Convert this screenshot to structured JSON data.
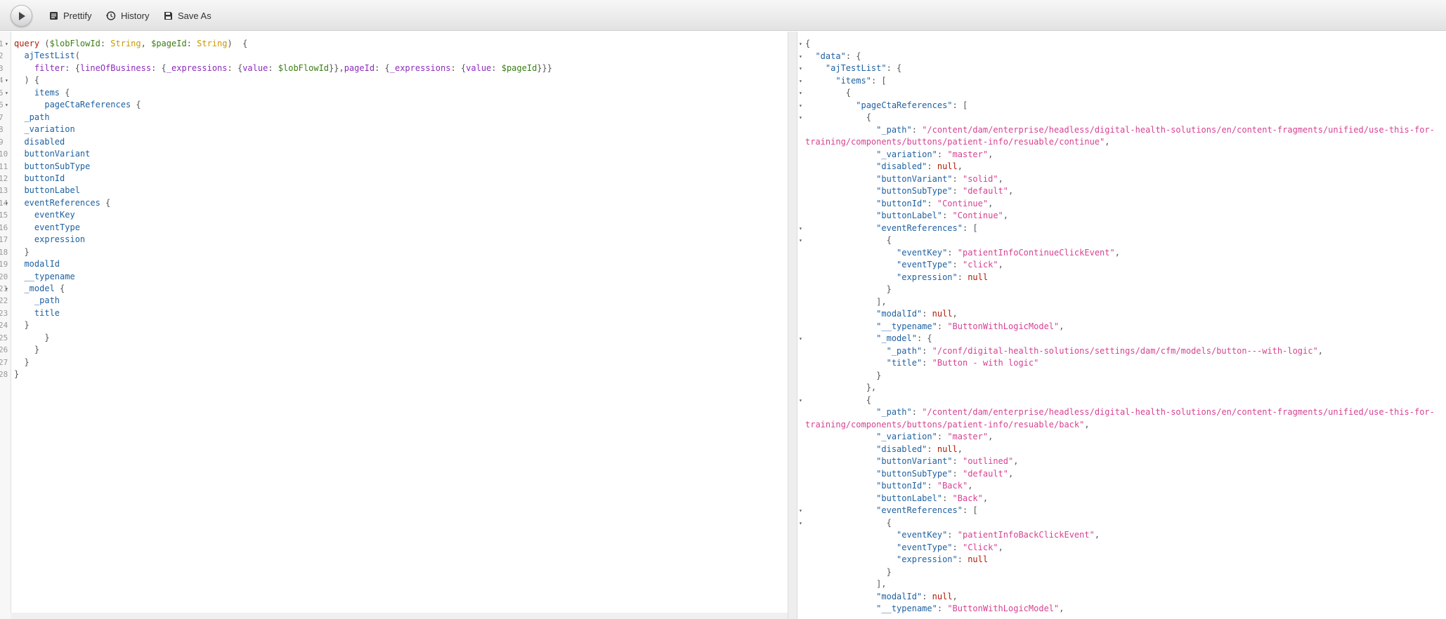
{
  "toolbar": {
    "run_label": "Execute Query",
    "prettify_label": "Prettify",
    "history_label": "History",
    "save_as_label": "Save As"
  },
  "query_lines": [
    {
      "n": "1",
      "fold": true,
      "tokens": [
        [
          "kw",
          "query"
        ],
        [
          "punc",
          " ("
        ],
        [
          "var",
          "$lobFlowId"
        ],
        [
          "punc",
          ": "
        ],
        [
          "type",
          "String"
        ],
        [
          "punc",
          ", "
        ],
        [
          "var",
          "$pageId"
        ],
        [
          "punc",
          ": "
        ],
        [
          "type",
          "String"
        ],
        [
          "punc",
          ")  {"
        ]
      ]
    },
    {
      "n": "2",
      "fold": false,
      "tokens": [
        [
          "punc",
          "  "
        ],
        [
          "prop",
          "ajTestList"
        ],
        [
          "punc",
          "("
        ]
      ]
    },
    {
      "n": "3",
      "fold": false,
      "tokens": [
        [
          "punc",
          "    "
        ],
        [
          "attr",
          "filter"
        ],
        [
          "punc",
          ": {"
        ],
        [
          "attr",
          "lineOfBusiness"
        ],
        [
          "punc",
          ": {"
        ],
        [
          "attr",
          "_expressions"
        ],
        [
          "punc",
          ": {"
        ],
        [
          "attr",
          "value"
        ],
        [
          "punc",
          ": "
        ],
        [
          "var",
          "$lobFlowId"
        ],
        [
          "punc",
          "}},"
        ],
        [
          "attr",
          "pageId"
        ],
        [
          "punc",
          ": {"
        ],
        [
          "attr",
          "_expressions"
        ],
        [
          "punc",
          ": {"
        ],
        [
          "attr",
          "value"
        ],
        [
          "punc",
          ": "
        ],
        [
          "var",
          "$pageId"
        ],
        [
          "punc",
          "}}}"
        ]
      ]
    },
    {
      "n": "4",
      "fold": true,
      "tokens": [
        [
          "punc",
          "  ) {"
        ]
      ]
    },
    {
      "n": "5",
      "fold": true,
      "tokens": [
        [
          "punc",
          "    "
        ],
        [
          "prop",
          "items"
        ],
        [
          "punc",
          " {"
        ]
      ]
    },
    {
      "n": "6",
      "fold": true,
      "tokens": [
        [
          "punc",
          "      "
        ],
        [
          "prop",
          "pageCtaReferences"
        ],
        [
          "punc",
          " {"
        ]
      ]
    },
    {
      "n": "7",
      "fold": false,
      "tokens": [
        [
          "punc",
          "  "
        ],
        [
          "prop",
          "_path"
        ]
      ]
    },
    {
      "n": "8",
      "fold": false,
      "tokens": [
        [
          "punc",
          "  "
        ],
        [
          "prop",
          "_variation"
        ]
      ]
    },
    {
      "n": "9",
      "fold": false,
      "tokens": [
        [
          "punc",
          "  "
        ],
        [
          "prop",
          "disabled"
        ]
      ]
    },
    {
      "n": "10",
      "fold": false,
      "tokens": [
        [
          "punc",
          "  "
        ],
        [
          "prop",
          "buttonVariant"
        ]
      ]
    },
    {
      "n": "11",
      "fold": false,
      "tokens": [
        [
          "punc",
          "  "
        ],
        [
          "prop",
          "buttonSubType"
        ]
      ]
    },
    {
      "n": "12",
      "fold": false,
      "tokens": [
        [
          "punc",
          "  "
        ],
        [
          "prop",
          "buttonId"
        ]
      ]
    },
    {
      "n": "13",
      "fold": false,
      "tokens": [
        [
          "punc",
          "  "
        ],
        [
          "prop",
          "buttonLabel"
        ]
      ]
    },
    {
      "n": "14",
      "fold": true,
      "tokens": [
        [
          "punc",
          "  "
        ],
        [
          "prop",
          "eventReferences"
        ],
        [
          "punc",
          " {"
        ]
      ]
    },
    {
      "n": "15",
      "fold": false,
      "tokens": [
        [
          "punc",
          "    "
        ],
        [
          "prop",
          "eventKey"
        ]
      ]
    },
    {
      "n": "16",
      "fold": false,
      "tokens": [
        [
          "punc",
          "    "
        ],
        [
          "prop",
          "eventType"
        ]
      ]
    },
    {
      "n": "17",
      "fold": false,
      "tokens": [
        [
          "punc",
          "    "
        ],
        [
          "prop",
          "expression"
        ]
      ]
    },
    {
      "n": "18",
      "fold": false,
      "tokens": [
        [
          "punc",
          "  }"
        ]
      ]
    },
    {
      "n": "19",
      "fold": false,
      "tokens": [
        [
          "punc",
          "  "
        ],
        [
          "prop",
          "modalId"
        ]
      ]
    },
    {
      "n": "20",
      "fold": false,
      "tokens": [
        [
          "punc",
          "  "
        ],
        [
          "prop",
          "__typename"
        ]
      ]
    },
    {
      "n": "21",
      "fold": true,
      "tokens": [
        [
          "punc",
          "  "
        ],
        [
          "prop",
          "_model"
        ],
        [
          "punc",
          " {"
        ]
      ]
    },
    {
      "n": "22",
      "fold": false,
      "tokens": [
        [
          "punc",
          "    "
        ],
        [
          "prop",
          "_path"
        ]
      ]
    },
    {
      "n": "23",
      "fold": false,
      "tokens": [
        [
          "punc",
          "    "
        ],
        [
          "prop",
          "title"
        ]
      ]
    },
    {
      "n": "24",
      "fold": false,
      "tokens": [
        [
          "punc",
          "  }"
        ]
      ]
    },
    {
      "n": "25",
      "fold": false,
      "tokens": [
        [
          "punc",
          "      }"
        ]
      ]
    },
    {
      "n": "26",
      "fold": false,
      "tokens": [
        [
          "punc",
          "    }"
        ]
      ]
    },
    {
      "n": "27",
      "fold": false,
      "tokens": [
        [
          "punc",
          "  }"
        ]
      ]
    },
    {
      "n": "28",
      "fold": false,
      "tokens": [
        [
          "punc",
          "}"
        ]
      ]
    }
  ],
  "result_lines": [
    {
      "fold": true,
      "tokens": [
        [
          "jp",
          "{"
        ]
      ]
    },
    {
      "fold": true,
      "tokens": [
        [
          "jp",
          "  "
        ],
        [
          "jkey",
          "\"data\""
        ],
        [
          "jp",
          ": {"
        ]
      ]
    },
    {
      "fold": true,
      "tokens": [
        [
          "jp",
          "    "
        ],
        [
          "jkey",
          "\"ajTestList\""
        ],
        [
          "jp",
          ": {"
        ]
      ]
    },
    {
      "fold": true,
      "tokens": [
        [
          "jp",
          "      "
        ],
        [
          "jkey",
          "\"items\""
        ],
        [
          "jp",
          ": ["
        ]
      ]
    },
    {
      "fold": true,
      "tokens": [
        [
          "jp",
          "        {"
        ]
      ]
    },
    {
      "fold": true,
      "tokens": [
        [
          "jp",
          "          "
        ],
        [
          "jkey",
          "\"pageCtaReferences\""
        ],
        [
          "jp",
          ": ["
        ]
      ]
    },
    {
      "fold": true,
      "tokens": [
        [
          "jp",
          "            {"
        ]
      ]
    },
    {
      "fold": false,
      "tokens": [
        [
          "jp",
          "              "
        ],
        [
          "jkey",
          "\"_path\""
        ],
        [
          "jp",
          ": "
        ],
        [
          "jstr",
          "\"/content/dam/enterprise/headless/digital-health-solutions/en/content-fragments/unified/use-this-for-"
        ]
      ]
    },
    {
      "fold": false,
      "tokens": [
        [
          "jstr",
          "training/components/buttons/patient-info/resuable/continue\""
        ],
        [
          "jp",
          ","
        ]
      ]
    },
    {
      "fold": false,
      "tokens": [
        [
          "jp",
          "              "
        ],
        [
          "jkey",
          "\"_variation\""
        ],
        [
          "jp",
          ": "
        ],
        [
          "jstr",
          "\"master\""
        ],
        [
          "jp",
          ","
        ]
      ]
    },
    {
      "fold": false,
      "tokens": [
        [
          "jp",
          "              "
        ],
        [
          "jkey",
          "\"disabled\""
        ],
        [
          "jp",
          ": "
        ],
        [
          "jnull",
          "null"
        ],
        [
          "jp",
          ","
        ]
      ]
    },
    {
      "fold": false,
      "tokens": [
        [
          "jp",
          "              "
        ],
        [
          "jkey",
          "\"buttonVariant\""
        ],
        [
          "jp",
          ": "
        ],
        [
          "jstr",
          "\"solid\""
        ],
        [
          "jp",
          ","
        ]
      ]
    },
    {
      "fold": false,
      "tokens": [
        [
          "jp",
          "              "
        ],
        [
          "jkey",
          "\"buttonSubType\""
        ],
        [
          "jp",
          ": "
        ],
        [
          "jstr",
          "\"default\""
        ],
        [
          "jp",
          ","
        ]
      ]
    },
    {
      "fold": false,
      "tokens": [
        [
          "jp",
          "              "
        ],
        [
          "jkey",
          "\"buttonId\""
        ],
        [
          "jp",
          ": "
        ],
        [
          "jstr",
          "\"Continue\""
        ],
        [
          "jp",
          ","
        ]
      ]
    },
    {
      "fold": false,
      "tokens": [
        [
          "jp",
          "              "
        ],
        [
          "jkey",
          "\"buttonLabel\""
        ],
        [
          "jp",
          ": "
        ],
        [
          "jstr",
          "\"Continue\""
        ],
        [
          "jp",
          ","
        ]
      ]
    },
    {
      "fold": true,
      "tokens": [
        [
          "jp",
          "              "
        ],
        [
          "jkey",
          "\"eventReferences\""
        ],
        [
          "jp",
          ": ["
        ]
      ]
    },
    {
      "fold": true,
      "tokens": [
        [
          "jp",
          "                {"
        ]
      ]
    },
    {
      "fold": false,
      "tokens": [
        [
          "jp",
          "                  "
        ],
        [
          "jkey",
          "\"eventKey\""
        ],
        [
          "jp",
          ": "
        ],
        [
          "jstr",
          "\"patientInfoContinueClickEvent\""
        ],
        [
          "jp",
          ","
        ]
      ]
    },
    {
      "fold": false,
      "tokens": [
        [
          "jp",
          "                  "
        ],
        [
          "jkey",
          "\"eventType\""
        ],
        [
          "jp",
          ": "
        ],
        [
          "jstr",
          "\"click\""
        ],
        [
          "jp",
          ","
        ]
      ]
    },
    {
      "fold": false,
      "tokens": [
        [
          "jp",
          "                  "
        ],
        [
          "jkey",
          "\"expression\""
        ],
        [
          "jp",
          ": "
        ],
        [
          "jnull",
          "null"
        ]
      ]
    },
    {
      "fold": false,
      "tokens": [
        [
          "jp",
          "                }"
        ]
      ]
    },
    {
      "fold": false,
      "tokens": [
        [
          "jp",
          "              ],"
        ]
      ]
    },
    {
      "fold": false,
      "tokens": [
        [
          "jp",
          "              "
        ],
        [
          "jkey",
          "\"modalId\""
        ],
        [
          "jp",
          ": "
        ],
        [
          "jnull",
          "null"
        ],
        [
          "jp",
          ","
        ]
      ]
    },
    {
      "fold": false,
      "tokens": [
        [
          "jp",
          "              "
        ],
        [
          "jkey",
          "\"__typename\""
        ],
        [
          "jp",
          ": "
        ],
        [
          "jstr",
          "\"ButtonWithLogicModel\""
        ],
        [
          "jp",
          ","
        ]
      ]
    },
    {
      "fold": true,
      "tokens": [
        [
          "jp",
          "              "
        ],
        [
          "jkey",
          "\"_model\""
        ],
        [
          "jp",
          ": {"
        ]
      ]
    },
    {
      "fold": false,
      "tokens": [
        [
          "jp",
          "                "
        ],
        [
          "jkey",
          "\"_path\""
        ],
        [
          "jp",
          ": "
        ],
        [
          "jstr",
          "\"/conf/digital-health-solutions/settings/dam/cfm/models/button---with-logic\""
        ],
        [
          "jp",
          ","
        ]
      ]
    },
    {
      "fold": false,
      "tokens": [
        [
          "jp",
          "                "
        ],
        [
          "jkey",
          "\"title\""
        ],
        [
          "jp",
          ": "
        ],
        [
          "jstr",
          "\"Button - with logic\""
        ]
      ]
    },
    {
      "fold": false,
      "tokens": [
        [
          "jp",
          "              }"
        ]
      ]
    },
    {
      "fold": false,
      "tokens": [
        [
          "jp",
          "            },"
        ]
      ]
    },
    {
      "fold": true,
      "tokens": [
        [
          "jp",
          "            {"
        ]
      ]
    },
    {
      "fold": false,
      "tokens": [
        [
          "jp",
          "              "
        ],
        [
          "jkey",
          "\"_path\""
        ],
        [
          "jp",
          ": "
        ],
        [
          "jstr",
          "\"/content/dam/enterprise/headless/digital-health-solutions/en/content-fragments/unified/use-this-for-"
        ]
      ]
    },
    {
      "fold": false,
      "tokens": [
        [
          "jstr",
          "training/components/buttons/patient-info/resuable/back\""
        ],
        [
          "jp",
          ","
        ]
      ]
    },
    {
      "fold": false,
      "tokens": [
        [
          "jp",
          "              "
        ],
        [
          "jkey",
          "\"_variation\""
        ],
        [
          "jp",
          ": "
        ],
        [
          "jstr",
          "\"master\""
        ],
        [
          "jp",
          ","
        ]
      ]
    },
    {
      "fold": false,
      "tokens": [
        [
          "jp",
          "              "
        ],
        [
          "jkey",
          "\"disabled\""
        ],
        [
          "jp",
          ": "
        ],
        [
          "jnull",
          "null"
        ],
        [
          "jp",
          ","
        ]
      ]
    },
    {
      "fold": false,
      "tokens": [
        [
          "jp",
          "              "
        ],
        [
          "jkey",
          "\"buttonVariant\""
        ],
        [
          "jp",
          ": "
        ],
        [
          "jstr",
          "\"outlined\""
        ],
        [
          "jp",
          ","
        ]
      ]
    },
    {
      "fold": false,
      "tokens": [
        [
          "jp",
          "              "
        ],
        [
          "jkey",
          "\"buttonSubType\""
        ],
        [
          "jp",
          ": "
        ],
        [
          "jstr",
          "\"default\""
        ],
        [
          "jp",
          ","
        ]
      ]
    },
    {
      "fold": false,
      "tokens": [
        [
          "jp",
          "              "
        ],
        [
          "jkey",
          "\"buttonId\""
        ],
        [
          "jp",
          ": "
        ],
        [
          "jstr",
          "\"Back\""
        ],
        [
          "jp",
          ","
        ]
      ]
    },
    {
      "fold": false,
      "tokens": [
        [
          "jp",
          "              "
        ],
        [
          "jkey",
          "\"buttonLabel\""
        ],
        [
          "jp",
          ": "
        ],
        [
          "jstr",
          "\"Back\""
        ],
        [
          "jp",
          ","
        ]
      ]
    },
    {
      "fold": true,
      "tokens": [
        [
          "jp",
          "              "
        ],
        [
          "jkey",
          "\"eventReferences\""
        ],
        [
          "jp",
          ": ["
        ]
      ]
    },
    {
      "fold": true,
      "tokens": [
        [
          "jp",
          "                {"
        ]
      ]
    },
    {
      "fold": false,
      "tokens": [
        [
          "jp",
          "                  "
        ],
        [
          "jkey",
          "\"eventKey\""
        ],
        [
          "jp",
          ": "
        ],
        [
          "jstr",
          "\"patientInfoBackClickEvent\""
        ],
        [
          "jp",
          ","
        ]
      ]
    },
    {
      "fold": false,
      "tokens": [
        [
          "jp",
          "                  "
        ],
        [
          "jkey",
          "\"eventType\""
        ],
        [
          "jp",
          ": "
        ],
        [
          "jstr",
          "\"Click\""
        ],
        [
          "jp",
          ","
        ]
      ]
    },
    {
      "fold": false,
      "tokens": [
        [
          "jp",
          "                  "
        ],
        [
          "jkey",
          "\"expression\""
        ],
        [
          "jp",
          ": "
        ],
        [
          "jnull",
          "null"
        ]
      ]
    },
    {
      "fold": false,
      "tokens": [
        [
          "jp",
          "                }"
        ]
      ]
    },
    {
      "fold": false,
      "tokens": [
        [
          "jp",
          "              ],"
        ]
      ]
    },
    {
      "fold": false,
      "tokens": [
        [
          "jp",
          "              "
        ],
        [
          "jkey",
          "\"modalId\""
        ],
        [
          "jp",
          ": "
        ],
        [
          "jnull",
          "null"
        ],
        [
          "jp",
          ","
        ]
      ]
    },
    {
      "fold": false,
      "tokens": [
        [
          "jp",
          "              "
        ],
        [
          "jkey",
          "\"__typename\""
        ],
        [
          "jp",
          ": "
        ],
        [
          "jstr",
          "\"ButtonWithLogicModel\""
        ],
        [
          "jp",
          ","
        ]
      ]
    }
  ],
  "colors": {
    "keyword": "#b11a04",
    "variable": "#397d13",
    "type": "#ca9800",
    "field": "#1f61a0",
    "argument": "#8b2bb9",
    "json_string": "#d64292",
    "json_null": "#b11a04"
  },
  "icons": {
    "run": "play-icon",
    "prettify": "prettify-icon",
    "history": "history-icon",
    "save_as": "save-icon"
  }
}
